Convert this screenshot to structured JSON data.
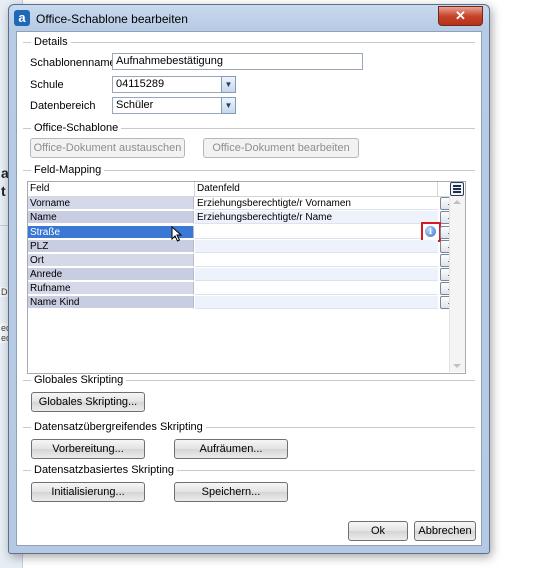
{
  "background_app": {
    "fragments": [
      "a M",
      "t C",
      "De",
      "echt",
      "echt"
    ]
  },
  "window": {
    "title": "Office-Schablone bearbeiten",
    "app_icon_letter": "a",
    "close_glyph": "✕"
  },
  "details": {
    "title": "Details",
    "template_name_label": "Schablonenname",
    "template_name_value": "Aufnahmebestätigung",
    "school_label": "Schule",
    "school_value": "04115289",
    "data_area_label": "Datenbereich",
    "data_area_value": "Schüler"
  },
  "office_template": {
    "title": "Office-Schablone",
    "replace_button": "Office-Dokument austauschen",
    "edit_button": "Office-Dokument bearbeiten"
  },
  "field_mapping": {
    "title": "Feld-Mapping",
    "columns": [
      "Feld",
      "Datenfeld"
    ],
    "rows": [
      {
        "field": "Vorname",
        "datafield": "Erziehungsberechtigte/r Vornamen"
      },
      {
        "field": "Name",
        "datafield": "Erziehungsberechtigte/r Name"
      },
      {
        "field": "Straße",
        "datafield": ""
      },
      {
        "field": "PLZ",
        "datafield": ""
      },
      {
        "field": "Ort",
        "datafield": ""
      },
      {
        "field": "Anrede",
        "datafield": ""
      },
      {
        "field": "Rufname",
        "datafield": ""
      },
      {
        "field": "Name Kind",
        "datafield": ""
      }
    ],
    "selected_row": "Straße",
    "ellipsis_label": "...",
    "info_icon_letter": "i",
    "info_icon": "info-icon",
    "column_chooser_icon": "column-chooser-icon"
  },
  "global_scripting": {
    "title": "Globales Skripting",
    "button": "Globales Skripting..."
  },
  "cross_record_scripting": {
    "title": "Datensatzübergreifendes Skripting",
    "prepare_button": "Vorbereitung...",
    "cleanup_button": "Aufräumen..."
  },
  "record_scripting": {
    "title": "Datensatzbasiertes Skripting",
    "init_button": "Initialisierung...",
    "save_button": "Speichern..."
  },
  "footer": {
    "ok_button": "Ok",
    "cancel_button": "Abbrechen"
  },
  "colors": {
    "selection": "#3b78d6",
    "highlight_box": "#d71920",
    "title_bar": "#c9daee"
  }
}
